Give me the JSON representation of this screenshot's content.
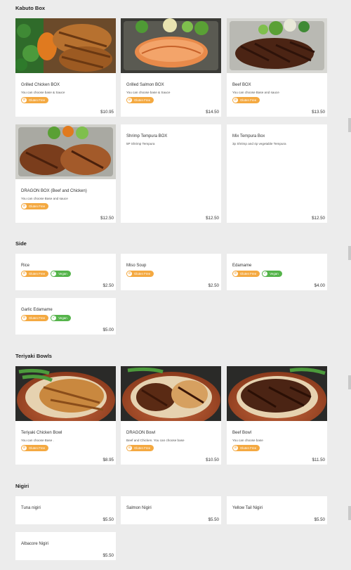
{
  "badges": {
    "gluten_free": "Gluten Free",
    "vegan": "Vegan"
  },
  "sections": {
    "kabuto": {
      "title": "Kabuto Box",
      "items": [
        {
          "name": "Grilled Chicken BOX",
          "desc": "You can choose base & Sauce",
          "price": "$10.95"
        },
        {
          "name": "Grilled Salmon BOX",
          "desc": "You can choose base & Sauce",
          "price": "$14.50"
        },
        {
          "name": "Beef BOX",
          "desc": "You can choose Base and sauce",
          "price": "$13.50"
        },
        {
          "name": "DRAGON BOX (Beef and Chicken)",
          "desc": "You can choose Base and sauce",
          "price": "$12.50"
        },
        {
          "name": "Shrimp Tempura BOX",
          "desc": "5P Shrimp Tempura",
          "price": "$12.50"
        },
        {
          "name": "Mix Tempura Box",
          "desc": "3p Shrimp and 4p vegetable Tempura",
          "price": "$12.50"
        }
      ]
    },
    "side": {
      "title": "Side",
      "items": [
        {
          "name": "Rice",
          "price": "$2.50"
        },
        {
          "name": "Miso Soup",
          "price": "$2.50"
        },
        {
          "name": "Edamame",
          "price": "$4.00"
        },
        {
          "name": "Garlic Edamame",
          "price": "$5.00"
        }
      ]
    },
    "teriyaki": {
      "title": "Teriyaki Bowls",
      "items": [
        {
          "name": "Teriyaki Chicken Bowl",
          "desc": "You can choose Base .",
          "price": "$8.95"
        },
        {
          "name": "DRAGON Bowl",
          "desc": "Beef and Chicken. You can choose base",
          "price": "$10.50"
        },
        {
          "name": "Beef Bowl",
          "desc": "You can choose base",
          "price": "$11.50"
        }
      ]
    },
    "nigiri": {
      "title": "Nigiri",
      "items": [
        {
          "name": "Tuna nigiri",
          "price": "$5.50"
        },
        {
          "name": "Salmon Nigiri",
          "price": "$5.50"
        },
        {
          "name": "Yellow Tail Nigiri",
          "price": "$5.50"
        },
        {
          "name": "Albacore Nigiri",
          "price": "$5.50"
        }
      ]
    }
  }
}
